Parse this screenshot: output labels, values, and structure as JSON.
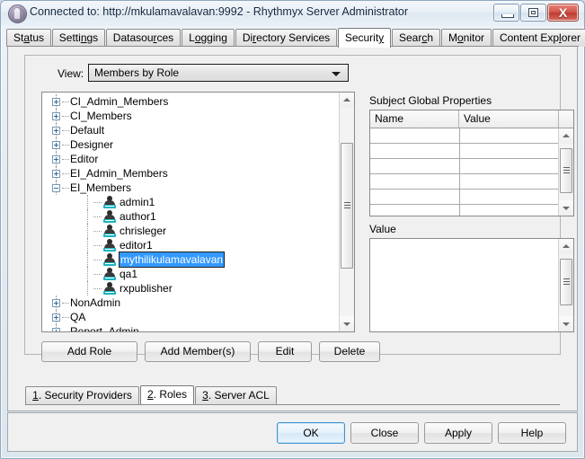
{
  "window": {
    "title": "Connected to: http://mkulamavalavan:9992 - Rhythmyx Server Administrator",
    "icon": "app-icon",
    "controls": {
      "minimize": "minimize-icon",
      "maximize": "maximize-icon",
      "close": "X"
    }
  },
  "tabs": [
    {
      "label": "Status",
      "mnemonic_index": 2,
      "active": false
    },
    {
      "label": "Settings",
      "mnemonic_index": 5,
      "active": false
    },
    {
      "label": "Datasources",
      "mnemonic_index": 7,
      "active": false
    },
    {
      "label": "Logging",
      "mnemonic_index": 1,
      "active": false
    },
    {
      "label": "Directory Services",
      "mnemonic_index": 2,
      "active": false
    },
    {
      "label": "Security",
      "mnemonic_index": 7,
      "active": true
    },
    {
      "label": "Search",
      "mnemonic_index": 4,
      "active": false
    },
    {
      "label": "Monitor",
      "mnemonic_index": 1,
      "active": false
    },
    {
      "label": "Content Explorer",
      "mnemonic_index": 11,
      "active": false
    }
  ],
  "view": {
    "label": "View:",
    "selected": "Members by Role",
    "options": [
      "Members by Role"
    ],
    "arrow": "chevron-down-icon"
  },
  "tree": {
    "nodes": [
      {
        "label": "CI_Admin_Members",
        "type": "role",
        "expanded": false
      },
      {
        "label": "CI_Members",
        "type": "role",
        "expanded": false
      },
      {
        "label": "Default",
        "type": "role",
        "expanded": false
      },
      {
        "label": "Designer",
        "type": "role",
        "expanded": false
      },
      {
        "label": "Editor",
        "type": "role",
        "expanded": false
      },
      {
        "label": "EI_Admin_Members",
        "type": "role",
        "expanded": false
      },
      {
        "label": "EI_Members",
        "type": "role",
        "expanded": true
      },
      {
        "label": "admin1",
        "type": "member",
        "selected": false
      },
      {
        "label": "author1",
        "type": "member",
        "selected": false
      },
      {
        "label": "chrisleger",
        "type": "member",
        "selected": false
      },
      {
        "label": "editor1",
        "type": "member",
        "selected": false
      },
      {
        "label": "mythilikulamavalavan",
        "type": "member",
        "selected": true
      },
      {
        "label": "qa1",
        "type": "member",
        "selected": false
      },
      {
        "label": "rxpublisher",
        "type": "member",
        "selected": false
      },
      {
        "label": "NonAdmin",
        "type": "role",
        "expanded": false
      },
      {
        "label": "QA",
        "type": "role",
        "expanded": false
      },
      {
        "label": "Report_Admin",
        "type": "role",
        "expanded": false
      }
    ],
    "scrollbar": {
      "up": "scroll-up-icon",
      "down": "scroll-down-icon"
    }
  },
  "subject_properties": {
    "title": "Subject Global Properties",
    "columns": [
      "Name",
      "Value"
    ],
    "rows": [],
    "empty_row_count": 7
  },
  "value_panel": {
    "label": "Value",
    "content": ""
  },
  "actions": {
    "add_role": "Add Role",
    "add_members": "Add Member(s)",
    "edit": "Edit",
    "delete": "Delete"
  },
  "bottom_tabs": [
    {
      "label": "1. Security Providers",
      "mnemonic_index": 0,
      "active": false
    },
    {
      "label": "2. Roles",
      "mnemonic_index": 0,
      "active": true
    },
    {
      "label": "3. Server ACL",
      "mnemonic_index": 0,
      "active": false
    }
  ],
  "dialog_buttons": {
    "ok": "OK",
    "close": "Close",
    "apply": "Apply",
    "help": "Help",
    "focused": "OK"
  },
  "colors": {
    "selection": "#3399ff",
    "selection_text": "#ffffff",
    "close_button": "#c0392b",
    "panel": "#f0f0f0",
    "field": "#ffffff"
  }
}
